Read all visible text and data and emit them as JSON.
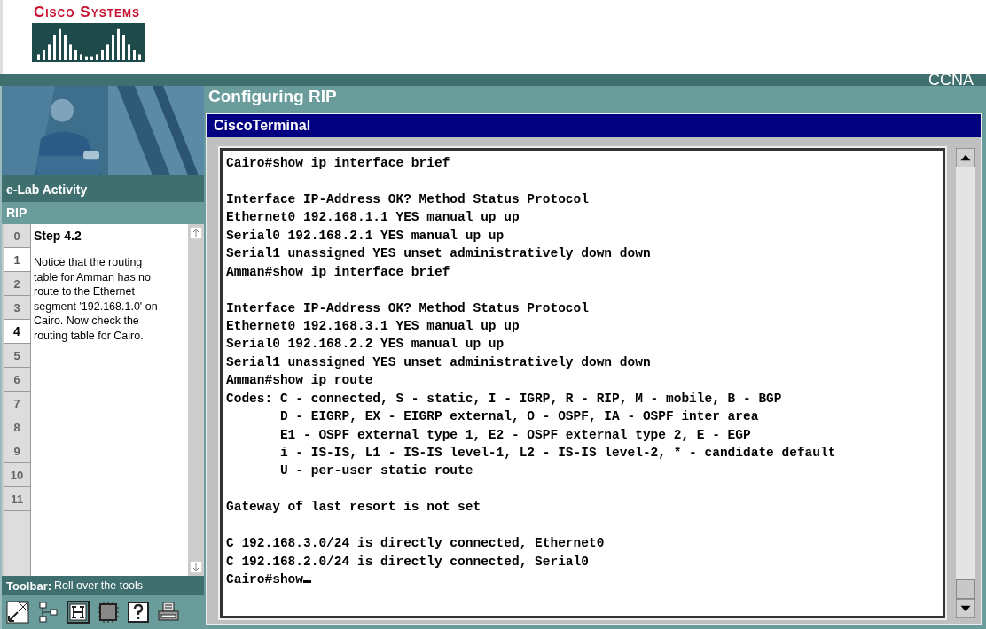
{
  "brand": {
    "wordmark": "Cisco Systems",
    "badge": "CCNA"
  },
  "sidebar": {
    "section_title": "e-Lab Activity",
    "lab_name": "RIP",
    "steps": [
      {
        "label": "0",
        "selected": false,
        "hovered": false
      },
      {
        "label": "1",
        "selected": false,
        "hovered": true
      },
      {
        "label": "2",
        "selected": false,
        "hovered": false
      },
      {
        "label": "3",
        "selected": false,
        "hovered": false
      },
      {
        "label": "4",
        "selected": true,
        "hovered": false
      },
      {
        "label": "5",
        "selected": false,
        "hovered": false
      },
      {
        "label": "6",
        "selected": false,
        "hovered": false
      },
      {
        "label": "7",
        "selected": false,
        "hovered": false
      },
      {
        "label": "8",
        "selected": false,
        "hovered": false
      },
      {
        "label": "9",
        "selected": false,
        "hovered": false
      },
      {
        "label": "10",
        "selected": false,
        "hovered": false
      },
      {
        "label": "11",
        "selected": false,
        "hovered": false
      }
    ],
    "step_title": "Step 4.2",
    "step_text": "Notice that the routing table for Amman has no route to the Ethernet segment '192.168.1.0' on Cairo. Now check the routing table for Cairo.",
    "toolbar": {
      "label": "Toolbar:",
      "hint": "Roll over the tools",
      "tools": [
        {
          "kind": "expand"
        },
        {
          "kind": "topology"
        },
        {
          "kind": "hint"
        },
        {
          "kind": "chip"
        },
        {
          "kind": "help"
        },
        {
          "kind": "print"
        }
      ]
    }
  },
  "page_title": "Configuring RIP",
  "terminal": {
    "title": "CiscoTerminal",
    "lines": [
      {
        "text": "Cairo#show ip interface brief",
        "blank_before": false
      },
      {
        "text": "Interface IP-Address OK? Method Status Protocol",
        "blank_before": true
      },
      {
        "text": "Ethernet0 192.168.1.1 YES manual up up",
        "blank_before": false
      },
      {
        "text": "Serial0 192.168.2.1 YES manual up up",
        "blank_before": false
      },
      {
        "text": "Serial1 unassigned YES unset administratively down down",
        "blank_before": false
      },
      {
        "text": "Amman#show ip interface brief",
        "blank_before": false
      },
      {
        "text": "Interface IP-Address OK? Method Status Protocol",
        "blank_before": true
      },
      {
        "text": "Ethernet0 192.168.3.1 YES manual up up",
        "blank_before": false
      },
      {
        "text": "Serial0 192.168.2.2 YES manual up up",
        "blank_before": false
      },
      {
        "text": "Serial1 unassigned YES unset administratively down down",
        "blank_before": false
      },
      {
        "text": "Amman#show ip route",
        "blank_before": false
      },
      {
        "text": "Codes: C - connected, S - static, I - IGRP, R - RIP, M - mobile, B - BGP",
        "blank_before": false
      },
      {
        "text": "       D - EIGRP, EX - EIGRP external, O - OSPF, IA - OSPF inter area",
        "blank_before": false
      },
      {
        "text": "       E1 - OSPF external type 1, E2 - OSPF external type 2, E - EGP",
        "blank_before": false
      },
      {
        "text": "       i - IS-IS, L1 - IS-IS level-1, L2 - IS-IS level-2, * - candidate default",
        "blank_before": false
      },
      {
        "text": "       U - per-user static route",
        "blank_before": false
      },
      {
        "text": "Gateway of last resort is not set",
        "blank_before": true
      },
      {
        "text": "C 192.168.3.0/24 is directly connected, Ethernet0",
        "blank_before": true
      },
      {
        "text": "C 192.168.2.0/24 is directly connected, Serial0",
        "blank_before": false
      },
      {
        "text": "Cairo#show",
        "blank_before": false
      }
    ],
    "cursor": true
  }
}
